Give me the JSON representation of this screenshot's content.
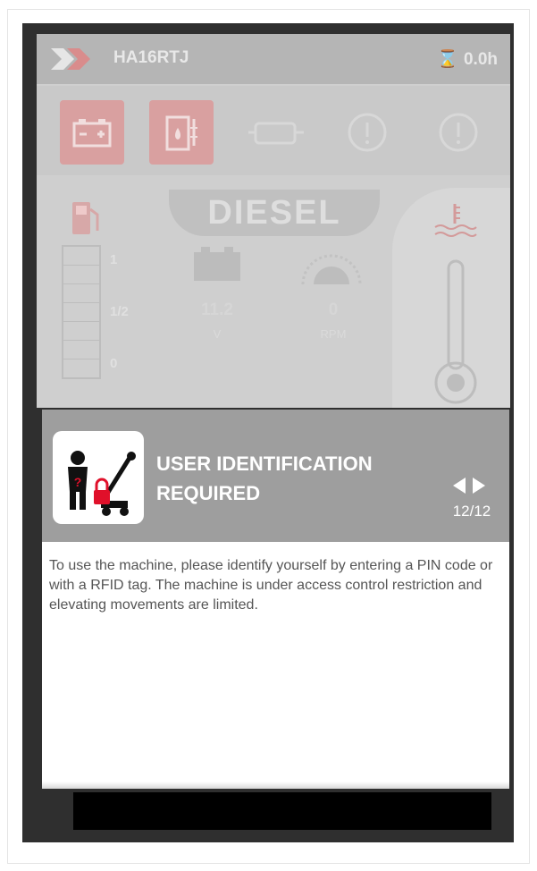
{
  "header": {
    "machine_id": "HA16RTJ",
    "hours": "0.0h"
  },
  "status_icons": [
    "battery-icon",
    "fuel-filter-icon",
    "engine-icon",
    "warning-icon",
    "brake-icon"
  ],
  "engine": {
    "fuel_type": "DIESEL",
    "fuel_levels": [
      "1",
      "1/2",
      "0"
    ],
    "voltage": "11.2",
    "voltage_unit": "V",
    "rpm": "0",
    "rpm_unit": "RPM"
  },
  "dialog": {
    "title_line1": "USER IDENTIFICATION",
    "title_line2": "REQUIRED",
    "page": "12/12",
    "body": "To use the machine, please identify yourself by entering a PIN code or with a RFID tag. The machine is under access control restriction and elevating movements are limited."
  },
  "colors": {
    "dialog_header": "#9e9e9e",
    "alert_red": "#d9a0a0",
    "lock_red": "#e0102a"
  }
}
